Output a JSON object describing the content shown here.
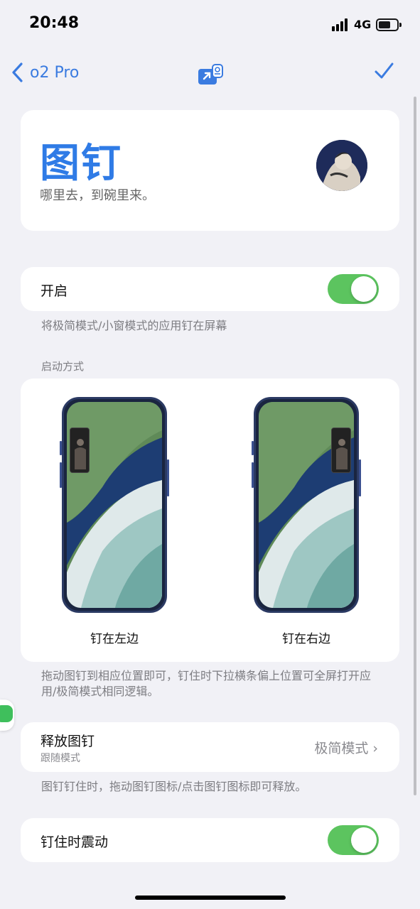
{
  "status_bar": {
    "time": "20:48",
    "network": "4G"
  },
  "nav": {
    "back_label": "o2 Pro",
    "back_icon": "chevron-left-icon",
    "center_icon": "pin-window-icon",
    "confirm_icon": "checkmark-icon",
    "accent_color": "#3a7be0"
  },
  "header": {
    "title": "图钉",
    "subtitle": "哪里去，到碗里来。",
    "title_color": "#2f7be6"
  },
  "enable": {
    "label": "开启",
    "on": true,
    "footnote": "将极简模式/小窗模式的应用钉在屏幕"
  },
  "launch": {
    "section_header": "启动方式",
    "options": [
      {
        "caption": "钉在左边",
        "side": "left"
      },
      {
        "caption": "钉在右边",
        "side": "right"
      }
    ],
    "footnote": "拖动图钉到相应位置即可，钉住时下拉横条偏上位置可全屏打开应用/极简模式相同逻辑。"
  },
  "release": {
    "title": "释放图钉",
    "subtitle": "跟随模式",
    "value": "极简模式 ›",
    "footnote": "图钉钉住时，拖动图钉图标/点击图钉图标即可释放。"
  },
  "vibrate": {
    "label": "钉住时震动",
    "on": true
  },
  "toggle_color": "#5cc45f"
}
